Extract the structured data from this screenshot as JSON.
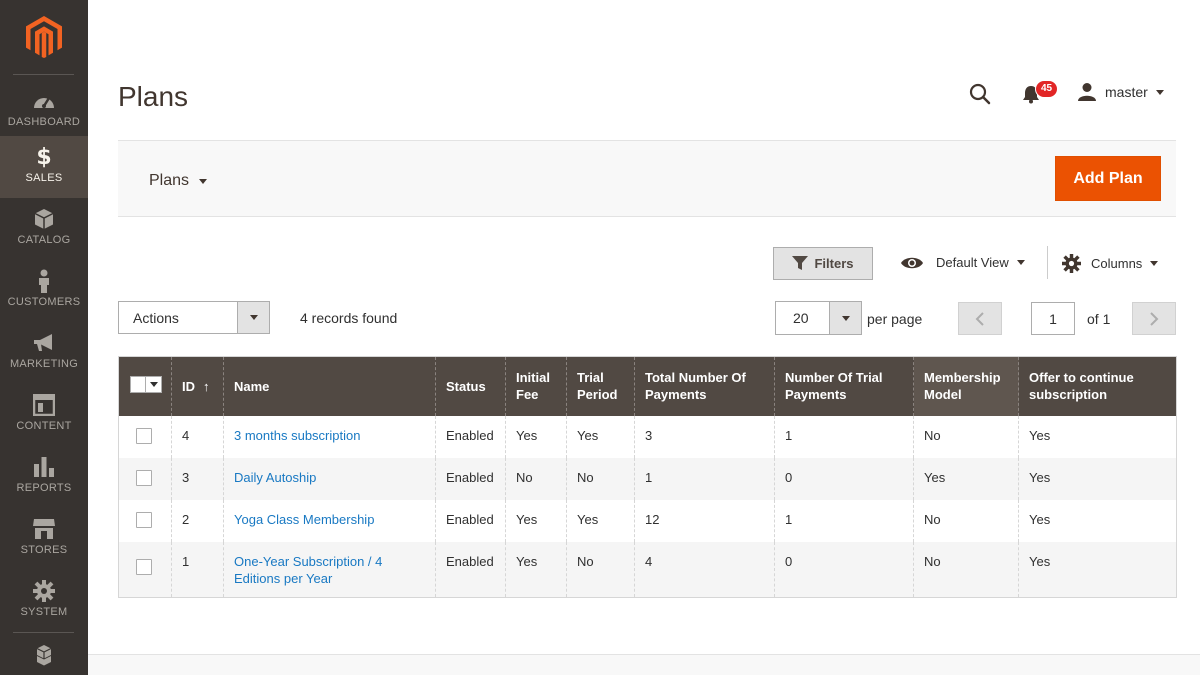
{
  "sidebar": {
    "items": [
      {
        "label": "DASHBOARD",
        "icon": "dashboard-icon"
      },
      {
        "label": "SALES",
        "icon": "dollar-icon",
        "active": true
      },
      {
        "label": "CATALOG",
        "icon": "box-icon"
      },
      {
        "label": "CUSTOMERS",
        "icon": "person-icon"
      },
      {
        "label": "MARKETING",
        "icon": "megaphone-icon"
      },
      {
        "label": "CONTENT",
        "icon": "layout-icon"
      },
      {
        "label": "REPORTS",
        "icon": "bar-chart-icon"
      },
      {
        "label": "STORES",
        "icon": "storefront-icon"
      },
      {
        "label": "SYSTEM",
        "icon": "gear-icon"
      }
    ]
  },
  "header": {
    "title": "Plans",
    "notification_count": "45",
    "username": "master"
  },
  "page_actions": {
    "switcher_label": "Plans",
    "add_button": "Add Plan"
  },
  "toolbar": {
    "filters_label": "Filters",
    "view_label": "Default View",
    "columns_label": "Columns",
    "actions_label": "Actions",
    "records_found": "4 records found",
    "per_page_value": "20",
    "per_page_label": "per page",
    "current_page": "1",
    "page_total": "of 1"
  },
  "grid": {
    "columns": [
      "ID",
      "Name",
      "Status",
      "Initial Fee",
      "Trial Period",
      "Total Number Of Payments",
      "Number Of Trial Payments",
      "Membership Model",
      "Offer to continue subscription"
    ],
    "sort_indicator": "↑",
    "rows": [
      {
        "id": "4",
        "name": "3 months subscription",
        "status": "Enabled",
        "initial_fee": "Yes",
        "trial_period": "Yes",
        "total_payments": "3",
        "trial_payments": "1",
        "membership_model": "No",
        "offer_continue": "Yes"
      },
      {
        "id": "3",
        "name": "Daily Autoship",
        "status": "Enabled",
        "initial_fee": "No",
        "trial_period": "No",
        "total_payments": "1",
        "trial_payments": "0",
        "membership_model": "Yes",
        "offer_continue": "Yes"
      },
      {
        "id": "2",
        "name": "Yoga Class Membership",
        "status": "Enabled",
        "initial_fee": "Yes",
        "trial_period": "Yes",
        "total_payments": "12",
        "trial_payments": "1",
        "membership_model": "No",
        "offer_continue": "Yes"
      },
      {
        "id": "1",
        "name": "One-Year Subscription / 4 Editions per Year",
        "status": "Enabled",
        "initial_fee": "Yes",
        "trial_period": "No",
        "total_payments": "4",
        "trial_payments": "0",
        "membership_model": "No",
        "offer_continue": "Yes"
      }
    ]
  },
  "colors": {
    "sidebar_bg": "#373330",
    "sidebar_active": "#514943",
    "accent": "#eb5202",
    "header_bg": "#514943",
    "link": "#1979c3"
  }
}
